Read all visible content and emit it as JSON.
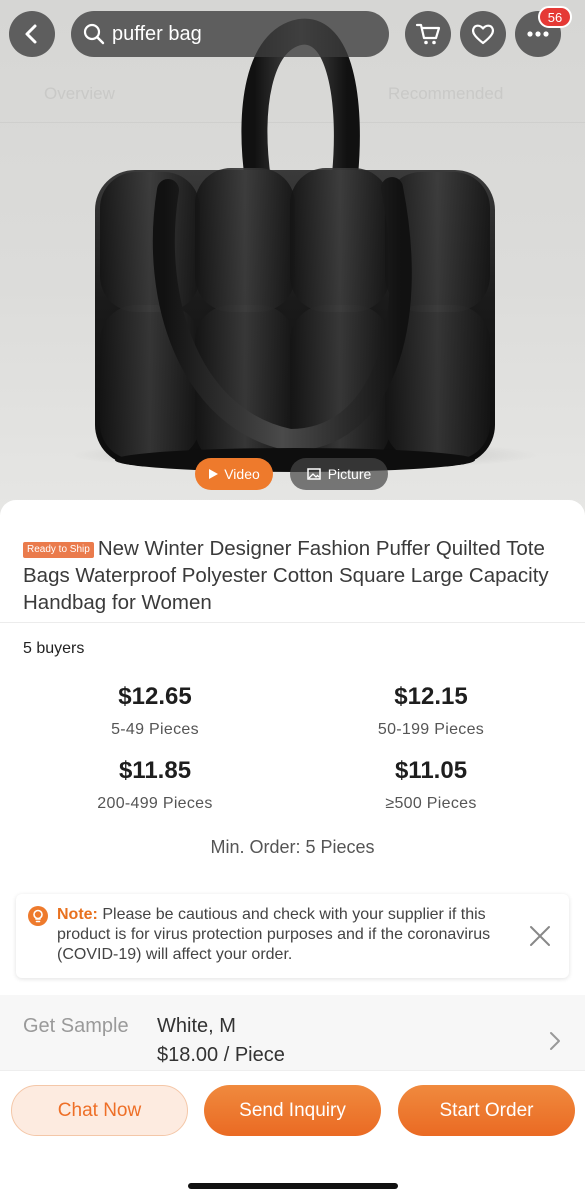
{
  "header": {
    "search_query": "puffer bag",
    "notification_count": "56",
    "icons": [
      "back-icon",
      "search-icon",
      "cart-icon",
      "heart-icon",
      "more-icon"
    ]
  },
  "hero": {
    "background_tabs": [
      "Overview",
      "Recommended"
    ],
    "media_buttons": {
      "video": "Video",
      "picture": "Picture"
    }
  },
  "product": {
    "badge": "Ready to Ship",
    "title": "New Winter Designer Fashion Puffer Quilted Tote Bags Waterproof Polyester Cotton Square Large Capacity Handbag for Women",
    "buyers": "5 buyers",
    "price_tiers": [
      {
        "price": "$12.65",
        "quantity": "5-49 Pieces"
      },
      {
        "price": "$12.15",
        "quantity": "50-199 Pieces"
      },
      {
        "price": "$11.85",
        "quantity": "200-499 Pieces"
      },
      {
        "price": "$11.05",
        "quantity": "≥500 Pieces"
      }
    ],
    "min_order": "Min. Order: 5 Pieces"
  },
  "note": {
    "label": "Note:",
    "text": " Please be cautious and check with your supplier if this product is for virus protection purposes and if the coronavirus (COVID-19) will affect your order."
  },
  "sample": {
    "label": "Get Sample",
    "variant": "White, M",
    "price": "$18.00 / Piece"
  },
  "actions": {
    "chat": "Chat Now",
    "inquiry": "Send Inquiry",
    "order": "Start Order"
  },
  "colors": {
    "accent": "#ee7a2c",
    "badge_red": "#e53935",
    "ready_badge": "#ea7b4c"
  }
}
